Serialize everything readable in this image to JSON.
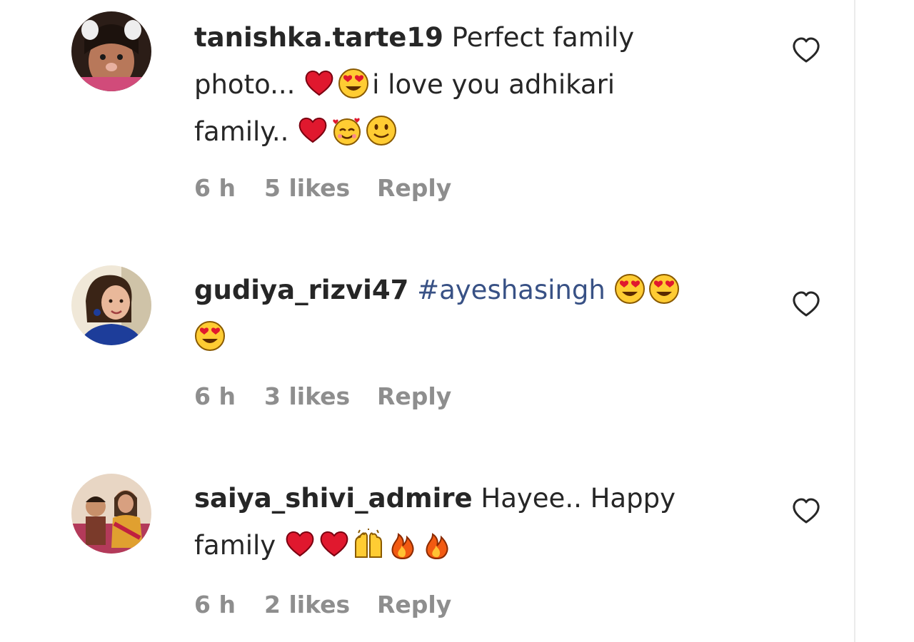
{
  "comments": [
    {
      "username": "tanishka.tarte19",
      "text_1": " Perfect family",
      "text_2": "photo... ",
      "text_3": "i love you adhikari",
      "text_4": "family.. ",
      "time": "6 h",
      "likes": "5 likes",
      "reply": "Reply"
    },
    {
      "username": "gudiya_rizvi47",
      "hashtag": "#ayeshasingh",
      "time": "6 h",
      "likes": "3 likes",
      "reply": "Reply"
    },
    {
      "username": "saiya_shivi_admire",
      "text_1": " Hayee.. Happy",
      "text_2": "family ",
      "time": "6 h",
      "likes": "2 likes",
      "reply": "Reply"
    }
  ],
  "colors": {
    "text": "#262626",
    "meta": "#8e8e8e",
    "hashtag": "#385185",
    "divider": "#ebebeb"
  }
}
